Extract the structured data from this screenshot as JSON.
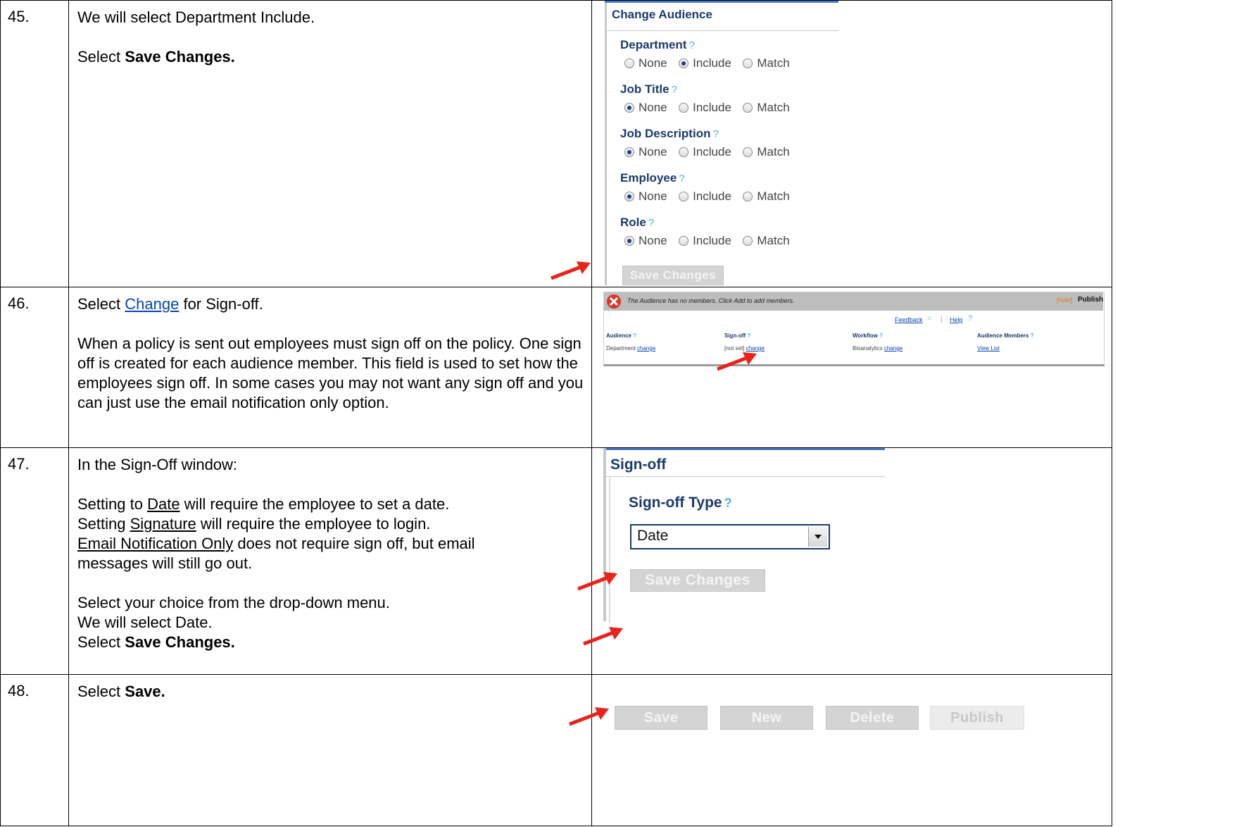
{
  "steps": [
    {
      "num": "45.",
      "instruction": {
        "line1": "We will select Department Include.",
        "line2_pre": "Select ",
        "line2_bold": "Save Changes."
      },
      "screenshot": {
        "panel_title": "Change Audience",
        "groups": [
          {
            "title": "Department",
            "selected": "Include"
          },
          {
            "title": "Job Title",
            "selected": "None"
          },
          {
            "title": "Job Description",
            "selected": "None"
          },
          {
            "title": "Employee",
            "selected": "None"
          },
          {
            "title": "Role",
            "selected": "None"
          }
        ],
        "options": [
          "None",
          "Include",
          "Match"
        ],
        "help_mark": "?",
        "save_button": "Save Changes"
      }
    },
    {
      "num": "46.",
      "instruction": {
        "pre": "Select ",
        "link": "Change",
        "post": " for Sign-off.",
        "paragraph": "When a policy is sent out employees must sign off on the policy. One sign off is created for each audience member.  This field is used to set how the employees sign off.  In some cases you may not want any sign off and you can just use the email notification only option."
      },
      "screenshot": {
        "error_message": "The Audience has no members. Click Add to add members.",
        "hide_link": "[hide]",
        "publish_label": "Publish",
        "feedback_link": "Feedback",
        "help_link": "Help",
        "columns": [
          {
            "header": "Audience",
            "value": "Department",
            "link": "change"
          },
          {
            "header": "Sign-off",
            "value": "[not set]",
            "link": "change"
          },
          {
            "header": "Workflow",
            "value": "Bioanalytics",
            "link": "change"
          },
          {
            "header": "Audience Members",
            "value": "",
            "link": "View List"
          }
        ]
      }
    },
    {
      "num": "47.",
      "instruction": {
        "intro": "In the Sign-Off window:",
        "date_word": "Date",
        "date_rest": " will require the employee to set a date.",
        "setting_to": "Setting to ",
        "setting": "Setting ",
        "signature_word": "Signature",
        "signature_rest": " will require the employee to login.",
        "email_word": "Email Notification Only",
        "email_rest": " does not require sign off, but email messages will still go out.",
        "choose": "Select your choice from the drop-down menu.",
        "we_select": "We will select Date.",
        "save_pre": "Select ",
        "save_bold": "Save Changes."
      },
      "screenshot": {
        "panel_title": "Sign-off",
        "field_label": "Sign-off Type",
        "help_mark": "?",
        "select_value": "Date",
        "save_button": "Save Changes"
      }
    },
    {
      "num": "48.",
      "instruction": {
        "pre": "Select ",
        "bold": "Save."
      },
      "screenshot": {
        "buttons": [
          "Save",
          "New",
          "Delete",
          "Publish"
        ]
      }
    }
  ],
  "colors": {
    "arrow": "#e8231b",
    "link": "#0645ad",
    "group_title": "#1b3a6b",
    "help_mark": "#4fb3e8"
  }
}
